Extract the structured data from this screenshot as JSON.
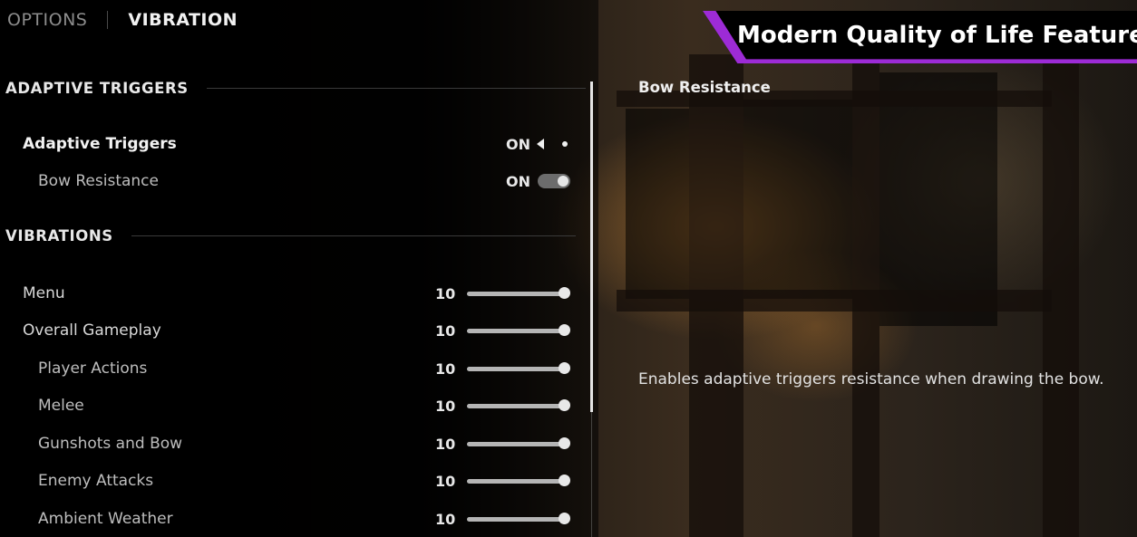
{
  "nav": {
    "tabs": [
      {
        "label": "OPTIONS",
        "active": false
      },
      {
        "label": "VIBRATION",
        "active": true
      }
    ]
  },
  "banner": {
    "text": "Modern Quality of Life Features",
    "accent": "#9d2bd6"
  },
  "sections": {
    "adaptive": {
      "title": "ADAPTIVE TRIGGERS",
      "rows": [
        {
          "label": "Adaptive Triggers",
          "value": "ON",
          "control": "selector"
        },
        {
          "label": "Bow Resistance",
          "value": "ON",
          "control": "toggle"
        }
      ]
    },
    "vibrations": {
      "title": "VIBRATIONS",
      "rows": [
        {
          "label": "Menu",
          "value": "10",
          "level": 1.0
        },
        {
          "label": "Overall Gameplay",
          "value": "10",
          "level": 1.0
        },
        {
          "label": "Player Actions",
          "value": "10",
          "level": 1.0
        },
        {
          "label": "Melee",
          "value": "10",
          "level": 1.0
        },
        {
          "label": "Gunshots and Bow",
          "value": "10",
          "level": 1.0
        },
        {
          "label": "Enemy Attacks",
          "value": "10",
          "level": 1.0
        },
        {
          "label": "Ambient Weather",
          "value": "10",
          "level": 1.0
        }
      ]
    }
  },
  "detail": {
    "title": "Bow Resistance",
    "description": "Enables adaptive triggers resistance when drawing the bow."
  }
}
